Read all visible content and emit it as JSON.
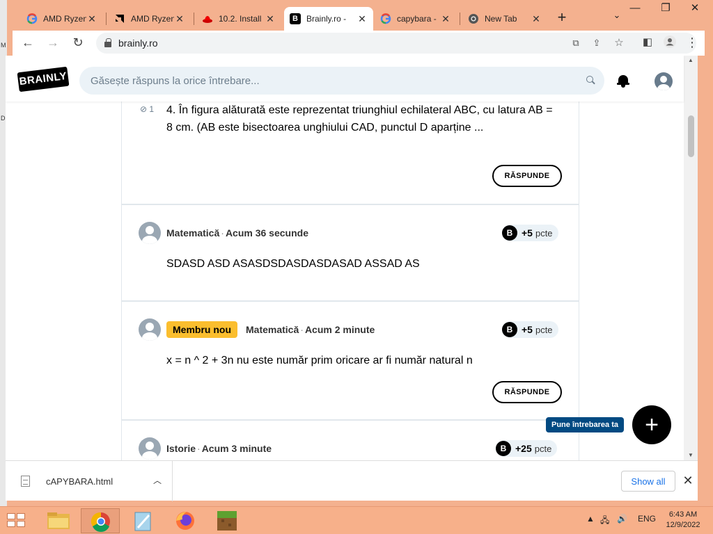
{
  "browser": {
    "tabs": [
      {
        "title": "AMD Ryzen",
        "favicon": "google-icon"
      },
      {
        "title": "AMD Ryzen",
        "favicon": "amd-icon"
      },
      {
        "title": "10.2. Install",
        "favicon": "redhat-icon"
      },
      {
        "title": "Brainly.ro -",
        "favicon": "brainly-icon",
        "active": true
      },
      {
        "title": "capybara -",
        "favicon": "google-icon"
      },
      {
        "title": "New Tab",
        "favicon": "chrome-icon"
      }
    ],
    "url": "brainly.ro"
  },
  "site": {
    "logo": "BRAINLY",
    "search_placeholder": "Găsește răspuns la orice întrebare...",
    "answer_label": "RĂSPUNDE",
    "points_unit": "pcte",
    "points_icon": "B",
    "ask_label": "Pune întrebarea ta",
    "ask_symbol": "+"
  },
  "questions": [
    {
      "attachments": "1",
      "text": "4. În figura alăturată este reprezentat triunghiul echilateral ABC, cu latura AB = 8 cm. (AB este bisectoarea unghiului CAD, punctul D aparține ..."
    },
    {
      "subject": "Matematică",
      "time": "Acum 36 secunde",
      "points": "+5",
      "text": "SDASD ASD ASASDSDASDASDASAD ASSAD AS"
    },
    {
      "badge": "Membru nou",
      "subject": "Matematică",
      "time": "Acum 2 minute",
      "points": "+5",
      "text": "x = n ^ 2 + 3n nu este număr prim oricare ar fi număr natural n"
    },
    {
      "subject": "Istorie",
      "time": "Acum 3 minute",
      "points": "+25"
    }
  ],
  "downloads": {
    "file_name": "cAPYBARA.html",
    "show_all": "Show all"
  },
  "taskbar": {
    "language": "ENG",
    "time": "6:43 AM",
    "date": "12/9/2022"
  },
  "colors": {
    "titlebar": "#f4b18f",
    "brainly_badge": "#fbbe2e",
    "fab_label": "#014a82",
    "search_bg": "#ebf2f7"
  }
}
